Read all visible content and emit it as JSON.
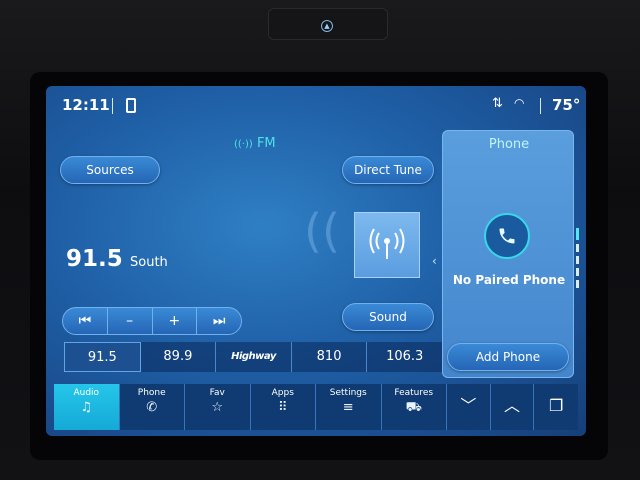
{
  "status": {
    "time": "12:11",
    "temperature": "75°"
  },
  "source": {
    "band": "FM"
  },
  "buttons": {
    "sources": "Sources",
    "direct_tune": "Direct Tune",
    "sound": "Sound"
  },
  "station": {
    "frequency": "91.5",
    "name": "South"
  },
  "tuner": {
    "seek_back": "⏮",
    "minus": "–",
    "plus": "+",
    "seek_forward": "⏭"
  },
  "presets": [
    {
      "label": "91.5"
    },
    {
      "label": "89.9"
    },
    {
      "label": "Highway"
    },
    {
      "label": "810"
    },
    {
      "label": "106.3"
    }
  ],
  "phone": {
    "title": "Phone",
    "status": "No Paired Phone",
    "add_button": "Add Phone"
  },
  "nav": [
    {
      "label": "Audio",
      "icon": "♫"
    },
    {
      "label": "Phone",
      "icon": "✆"
    },
    {
      "label": "Fav",
      "icon": "☆"
    },
    {
      "label": "Apps",
      "icon": "⠿"
    },
    {
      "label": "Settings",
      "icon": "≡"
    },
    {
      "label": "Features",
      "icon": "⛟"
    }
  ],
  "colors": {
    "accent": "#25c6ea",
    "screen_bg": "#1f5fa6",
    "highlight_text": "#4fe0e8"
  }
}
